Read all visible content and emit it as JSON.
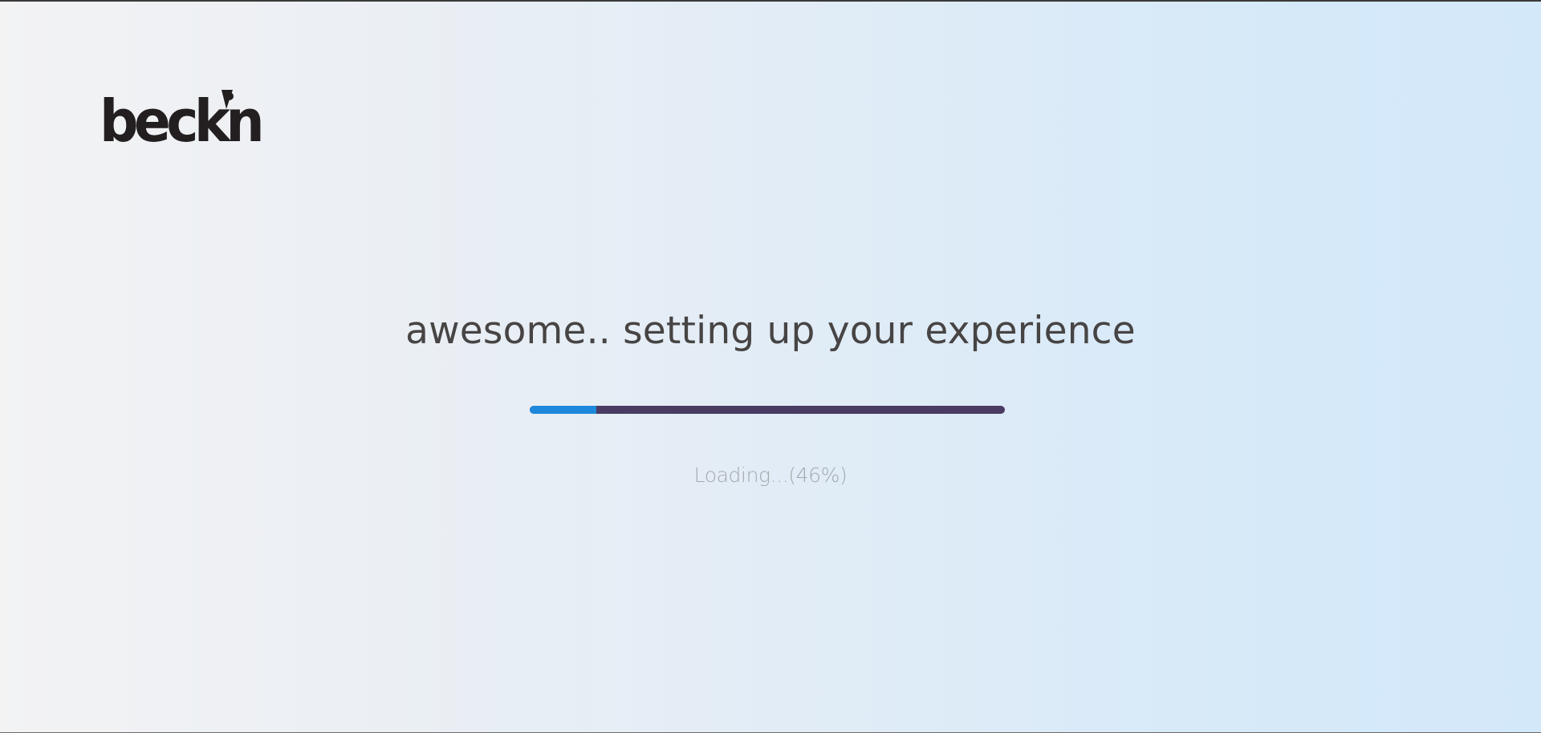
{
  "brand": {
    "logo_text": "beckn",
    "logo_color": "#231f20"
  },
  "main": {
    "headline": "awesome.. setting up your experience",
    "progress": {
      "percent": 14,
      "track_color": "#4a3b62",
      "fill_color": "#1e88dc"
    },
    "loading_text": "Loading...(46%)"
  }
}
